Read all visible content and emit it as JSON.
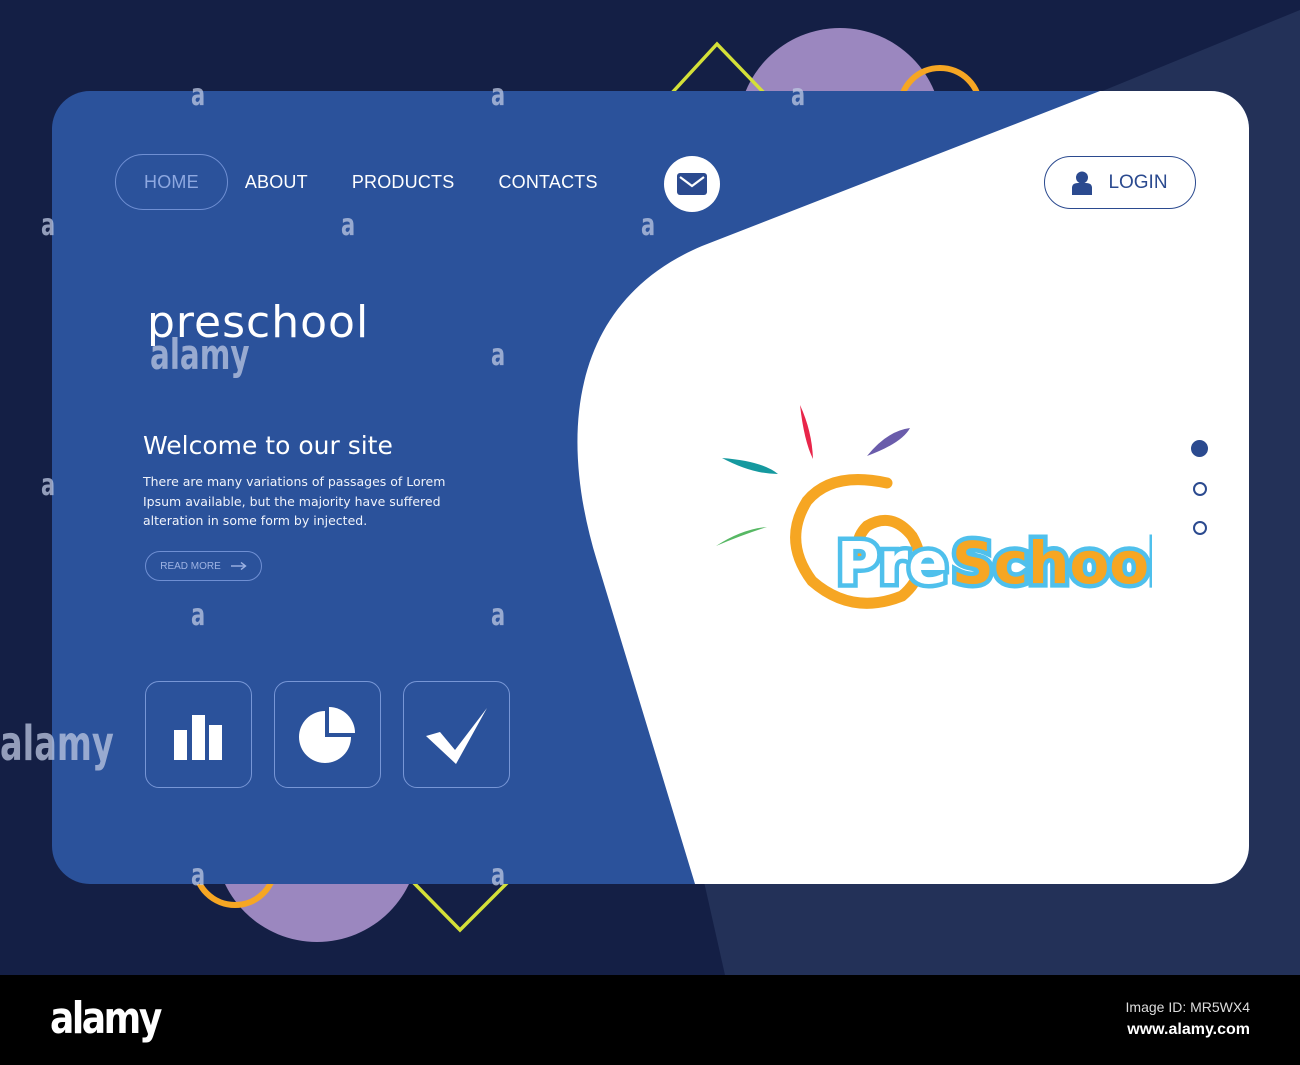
{
  "nav": {
    "items": [
      {
        "label": "HOME",
        "active": true
      },
      {
        "label": "ABOUT",
        "active": false
      },
      {
        "label": "PRODUCTS",
        "active": false
      },
      {
        "label": "CONTACTS",
        "active": false
      }
    ],
    "mail_icon": "envelope-icon",
    "login_label": "LOGIN",
    "login_icon": "user-icon"
  },
  "hero": {
    "title": "preschool",
    "welcome": "Welcome to our site",
    "description": "There are many variations of passages of Lorem Ipsum available, but the majority have suffered alteration in some form by injected.",
    "read_more_label": "READ MORE",
    "read_more_icon": "arrow-right-icon"
  },
  "features": [
    {
      "icon": "bar-chart-icon"
    },
    {
      "icon": "pie-chart-icon"
    },
    {
      "icon": "checkmark-icon"
    }
  ],
  "logo": {
    "text_part1": "Pre",
    "text_part2": "School"
  },
  "slider": {
    "count": 3,
    "active_index": 0
  },
  "watermark": {
    "text": "alamy",
    "letter": "a",
    "image_id": "Image ID: MR5WX4",
    "url": "www.alamy.com"
  },
  "colors": {
    "background": "#141f45",
    "background_light": "#233158",
    "card_blue": "#2b529b",
    "accent_dark_blue": "#2b4a8f",
    "lavender": "#9b87bf",
    "yellow_green": "#d4e038",
    "orange": "#f6a623"
  }
}
